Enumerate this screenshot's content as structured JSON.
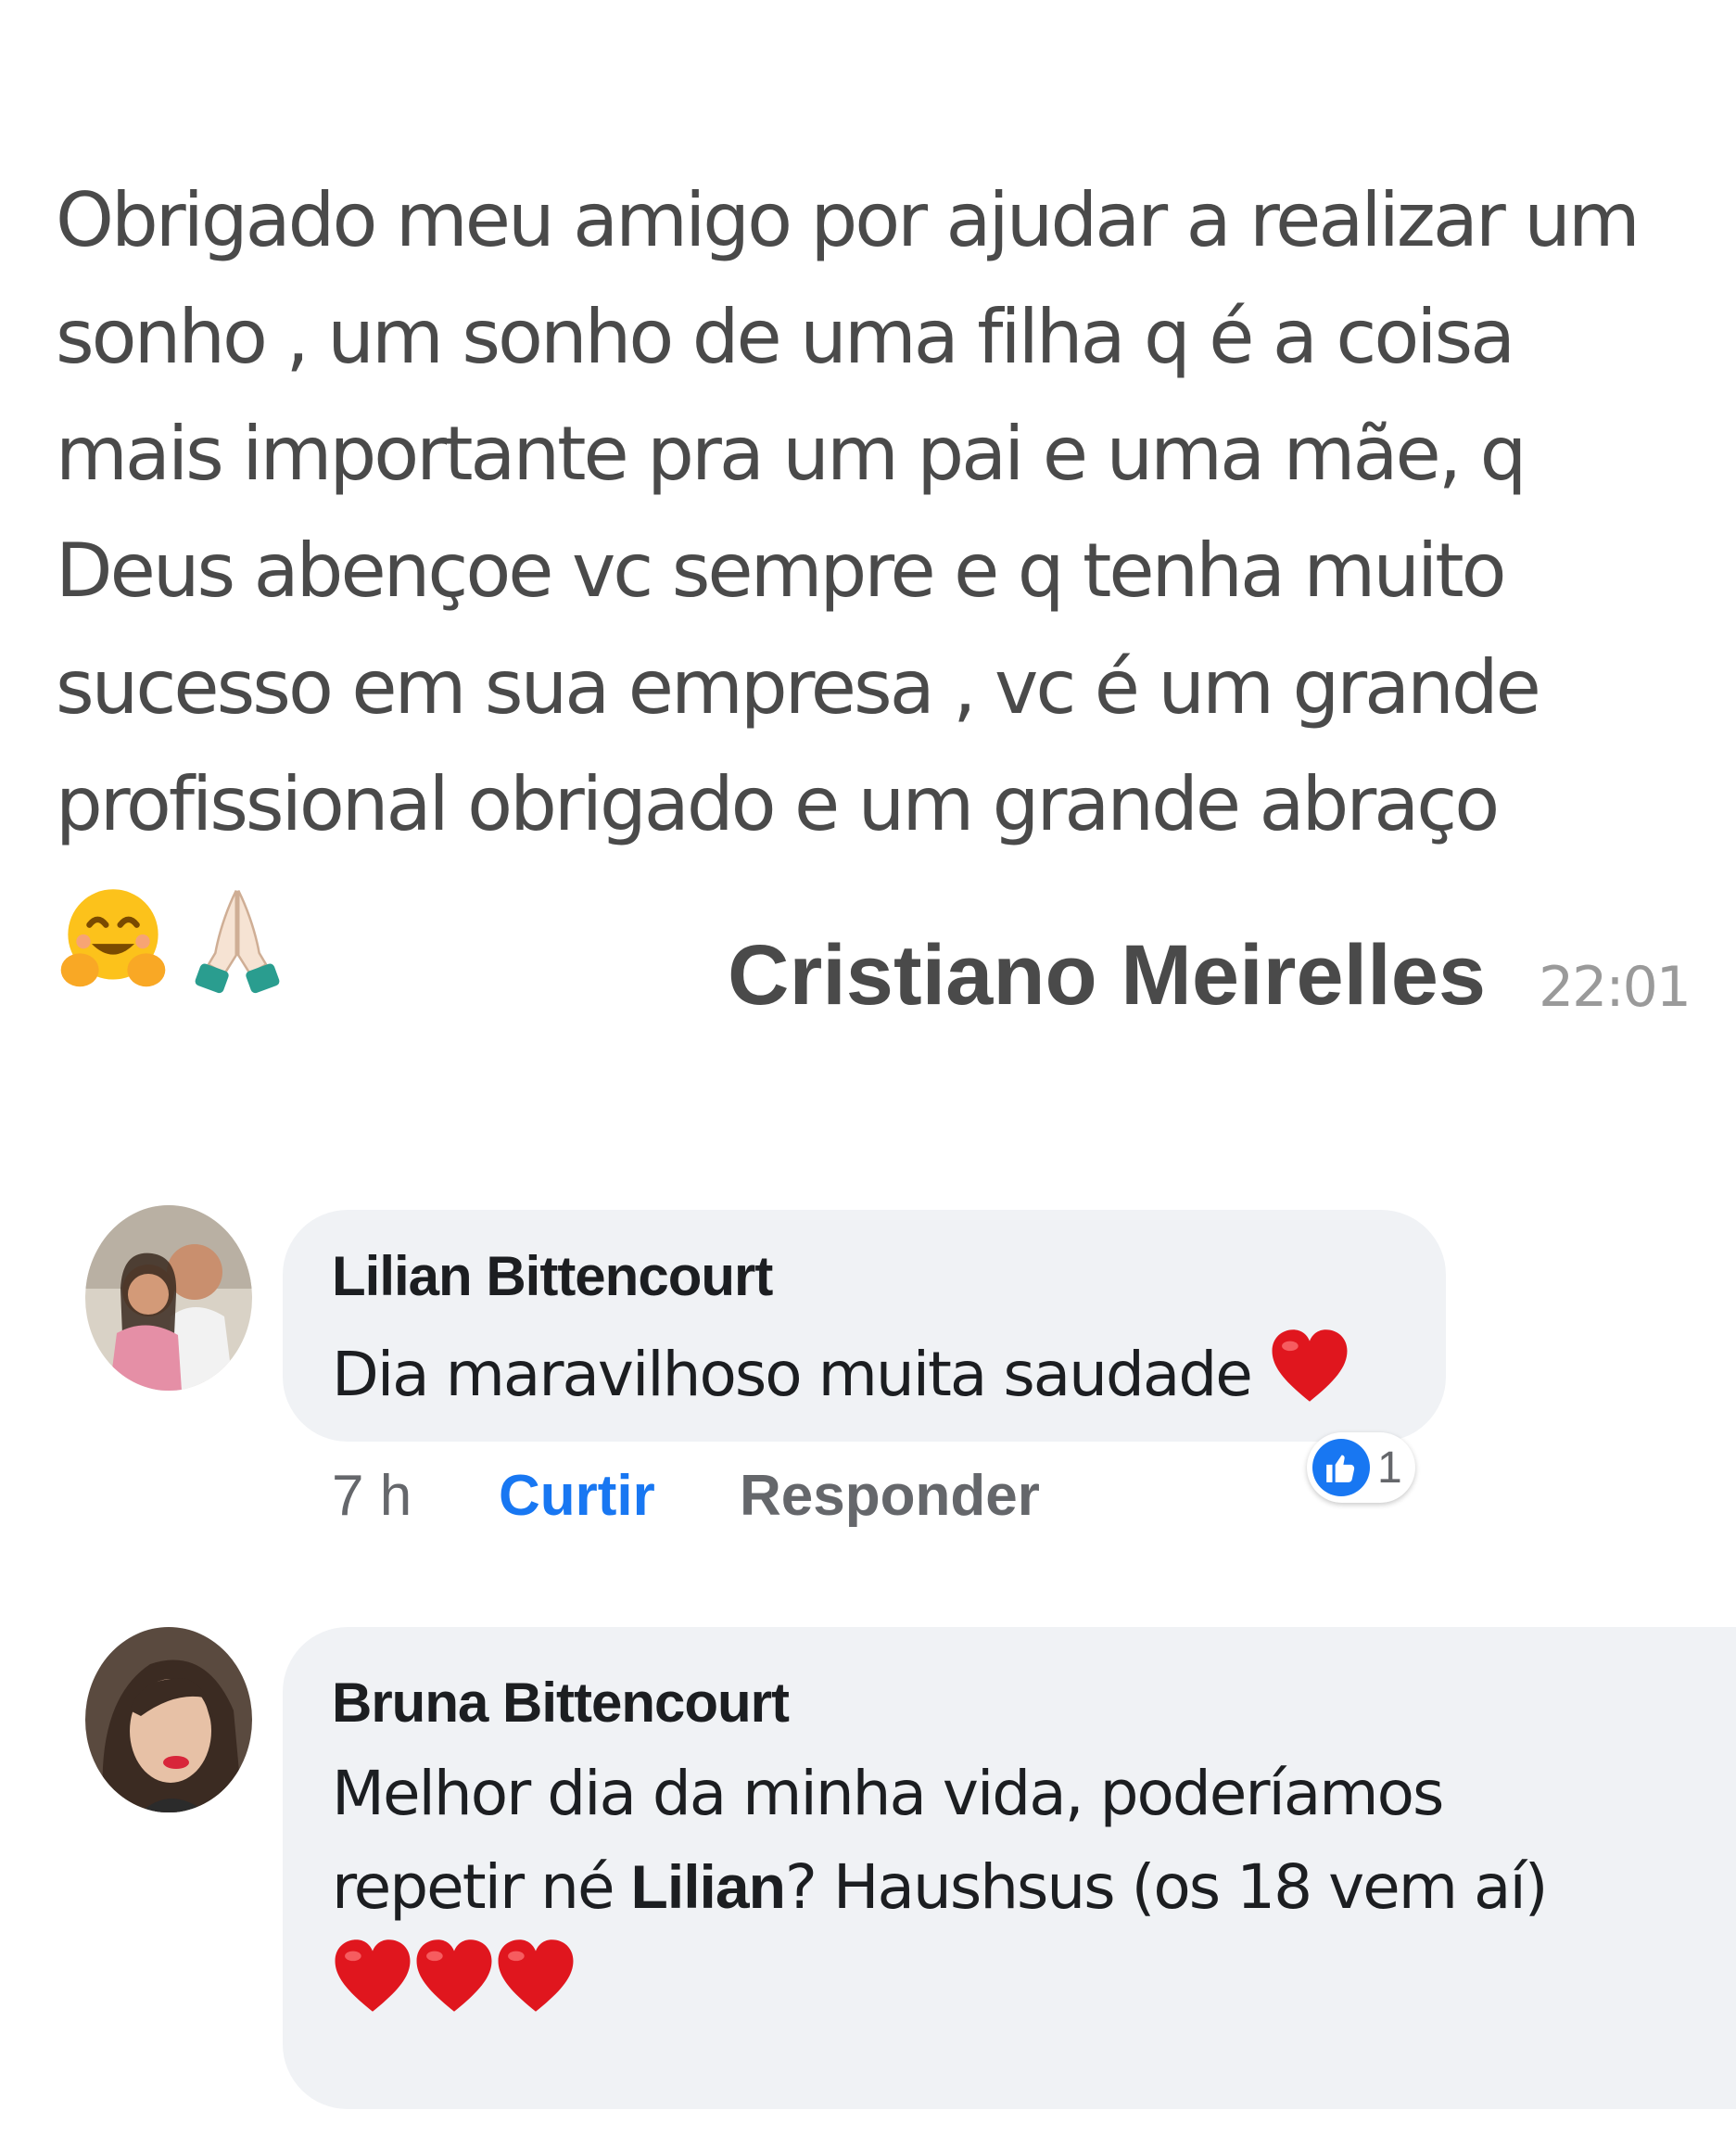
{
  "post": {
    "message_lines": [
      "Obrigado meu amigo por ajudar a realizar um",
      "sonho , um sonho de uma filha  q é  a coisa",
      "mais importante pra um pai e uma mãe, q",
      "Deus abençoe vc sempre e q tenha muito",
      "sucesso em sua empresa , vc é um grande",
      "profissional obrigado  e um grande abraço"
    ],
    "emojis": [
      "hugging-face-emoji",
      "folded-hands-emoji"
    ],
    "author": "Cristiano Meirelles",
    "time": "22:01"
  },
  "comments": [
    {
      "name": "Lilian Bittencourt",
      "text_lines": [
        "Dia maravilhoso muita saudade"
      ],
      "time": "7 h",
      "like_label": "Curtir",
      "reply_label": "Responder",
      "reaction_count": "1",
      "colors": {
        "like": "#1877f2",
        "heart": "#e0161e"
      }
    },
    {
      "name": "Bruna Bittencourt",
      "line1": "Melhor dia da minha vida, poderíamos",
      "line2_pre": "repetir né ",
      "mention": "Lilian",
      "line2_post": "? Haushsus (os 18 vem aí)"
    }
  ]
}
